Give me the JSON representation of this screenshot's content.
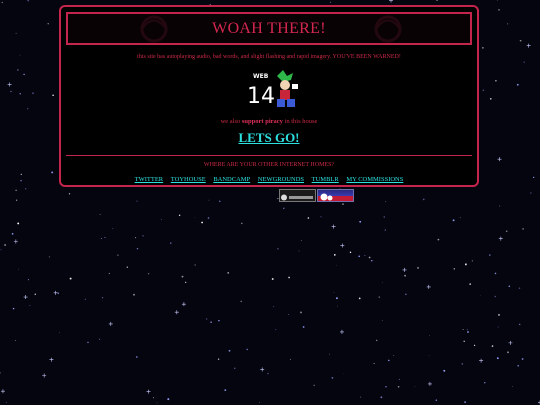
{
  "header": {
    "title": "WOAH THERE!"
  },
  "warning_text": "this site has autoplaying audio, bad words, and slight flashing and rapid imagery. YOU'VE BEEN WARNED!",
  "badge": {
    "label_top": "WEB",
    "label_number": "14"
  },
  "piracy": {
    "prefix": "we also ",
    "highlight": "support piracy",
    "suffix": " in this house"
  },
  "cta_label": "LETS GO!",
  "homes_heading": "WHERE ARE YOUR OTHER INTERNET HOMES?",
  "links": [
    {
      "label": "TWITTER"
    },
    {
      "label": "TOYHOUSE"
    },
    {
      "label": "BANDCAMP"
    },
    {
      "label": "NEWGROUNDS"
    },
    {
      "label": "TUMBLR"
    },
    {
      "label": "MY COMMISSIONS"
    }
  ],
  "colors": {
    "accent": "#c4254c",
    "link": "#2de0e0",
    "background": "#05050f"
  }
}
